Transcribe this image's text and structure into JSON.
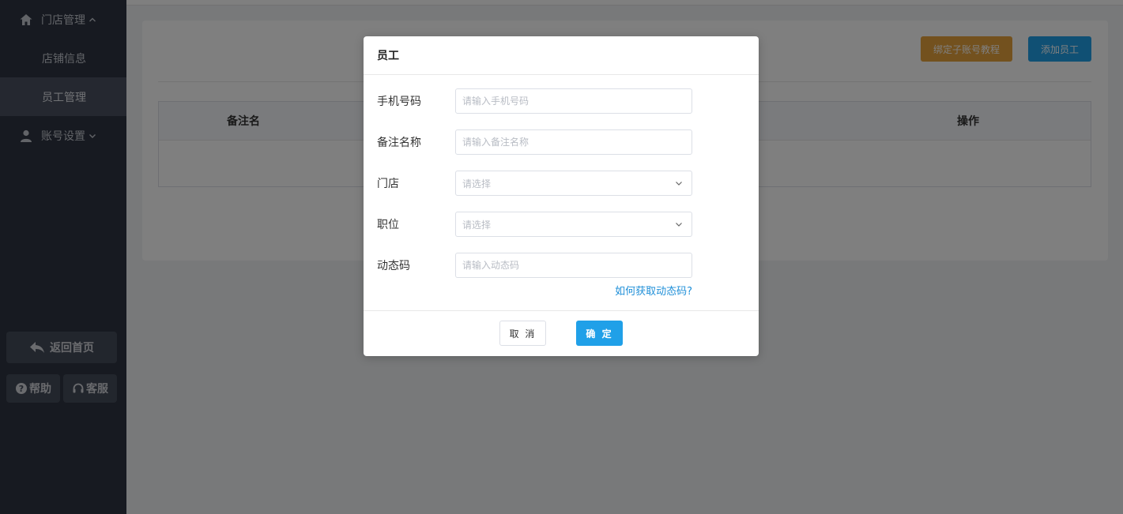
{
  "sidebar": {
    "store_group": {
      "label": "门店管理",
      "icon": "home-icon",
      "expanded": true
    },
    "store_items": [
      {
        "label": "店铺信息",
        "active": false
      },
      {
        "label": "员工管理",
        "active": true
      }
    ],
    "account_group": {
      "label": "账号设置",
      "icon": "user-icon",
      "expanded": false
    },
    "home_button": "返回首页",
    "help_button": "帮助",
    "service_button": "客服"
  },
  "toolbar": {
    "bind_tutorial": "绑定子账号教程",
    "add_staff": "添加员工"
  },
  "table": {
    "columns": [
      "备注名",
      "操作"
    ]
  },
  "dialog": {
    "title": "员工",
    "fields": {
      "phone": {
        "label": "手机号码",
        "placeholder": "请输入手机号码",
        "value": ""
      },
      "remark": {
        "label": "备注名称",
        "placeholder": "请输入备注名称",
        "value": ""
      },
      "store": {
        "label": "门店",
        "placeholder": "请选择"
      },
      "position": {
        "label": "职位",
        "placeholder": "请选择"
      },
      "code": {
        "label": "动态码",
        "placeholder": "请输入动态码",
        "value": ""
      }
    },
    "help_link": "如何获取动态码?",
    "cancel": "取 消",
    "confirm": "确 定"
  },
  "colors": {
    "sidebar_bg": "#2f3542",
    "primary": "#20a0e8",
    "warning": "#e6a23c",
    "link": "#1f8fd8"
  }
}
